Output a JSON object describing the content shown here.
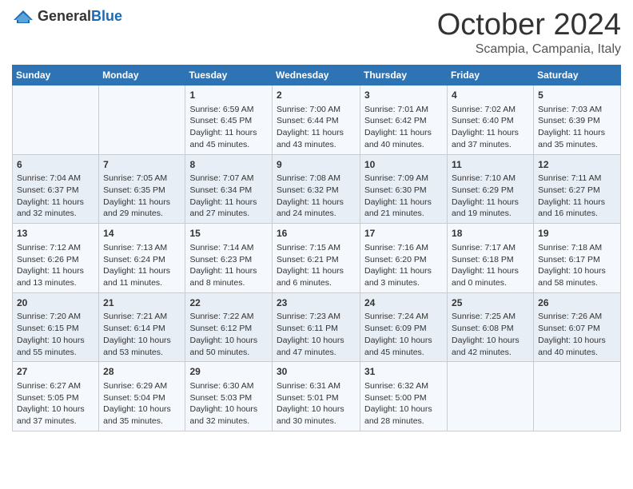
{
  "logo": {
    "general": "General",
    "blue": "Blue"
  },
  "header": {
    "month": "October 2024",
    "location": "Scampia, Campania, Italy"
  },
  "weekdays": [
    "Sunday",
    "Monday",
    "Tuesday",
    "Wednesday",
    "Thursday",
    "Friday",
    "Saturday"
  ],
  "weeks": [
    [
      {
        "day": "",
        "sunrise": "",
        "sunset": "",
        "daylight": ""
      },
      {
        "day": "",
        "sunrise": "",
        "sunset": "",
        "daylight": ""
      },
      {
        "day": "1",
        "sunrise": "Sunrise: 6:59 AM",
        "sunset": "Sunset: 6:45 PM",
        "daylight": "Daylight: 11 hours and 45 minutes."
      },
      {
        "day": "2",
        "sunrise": "Sunrise: 7:00 AM",
        "sunset": "Sunset: 6:44 PM",
        "daylight": "Daylight: 11 hours and 43 minutes."
      },
      {
        "day": "3",
        "sunrise": "Sunrise: 7:01 AM",
        "sunset": "Sunset: 6:42 PM",
        "daylight": "Daylight: 11 hours and 40 minutes."
      },
      {
        "day": "4",
        "sunrise": "Sunrise: 7:02 AM",
        "sunset": "Sunset: 6:40 PM",
        "daylight": "Daylight: 11 hours and 37 minutes."
      },
      {
        "day": "5",
        "sunrise": "Sunrise: 7:03 AM",
        "sunset": "Sunset: 6:39 PM",
        "daylight": "Daylight: 11 hours and 35 minutes."
      }
    ],
    [
      {
        "day": "6",
        "sunrise": "Sunrise: 7:04 AM",
        "sunset": "Sunset: 6:37 PM",
        "daylight": "Daylight: 11 hours and 32 minutes."
      },
      {
        "day": "7",
        "sunrise": "Sunrise: 7:05 AM",
        "sunset": "Sunset: 6:35 PM",
        "daylight": "Daylight: 11 hours and 29 minutes."
      },
      {
        "day": "8",
        "sunrise": "Sunrise: 7:07 AM",
        "sunset": "Sunset: 6:34 PM",
        "daylight": "Daylight: 11 hours and 27 minutes."
      },
      {
        "day": "9",
        "sunrise": "Sunrise: 7:08 AM",
        "sunset": "Sunset: 6:32 PM",
        "daylight": "Daylight: 11 hours and 24 minutes."
      },
      {
        "day": "10",
        "sunrise": "Sunrise: 7:09 AM",
        "sunset": "Sunset: 6:30 PM",
        "daylight": "Daylight: 11 hours and 21 minutes."
      },
      {
        "day": "11",
        "sunrise": "Sunrise: 7:10 AM",
        "sunset": "Sunset: 6:29 PM",
        "daylight": "Daylight: 11 hours and 19 minutes."
      },
      {
        "day": "12",
        "sunrise": "Sunrise: 7:11 AM",
        "sunset": "Sunset: 6:27 PM",
        "daylight": "Daylight: 11 hours and 16 minutes."
      }
    ],
    [
      {
        "day": "13",
        "sunrise": "Sunrise: 7:12 AM",
        "sunset": "Sunset: 6:26 PM",
        "daylight": "Daylight: 11 hours and 13 minutes."
      },
      {
        "day": "14",
        "sunrise": "Sunrise: 7:13 AM",
        "sunset": "Sunset: 6:24 PM",
        "daylight": "Daylight: 11 hours and 11 minutes."
      },
      {
        "day": "15",
        "sunrise": "Sunrise: 7:14 AM",
        "sunset": "Sunset: 6:23 PM",
        "daylight": "Daylight: 11 hours and 8 minutes."
      },
      {
        "day": "16",
        "sunrise": "Sunrise: 7:15 AM",
        "sunset": "Sunset: 6:21 PM",
        "daylight": "Daylight: 11 hours and 6 minutes."
      },
      {
        "day": "17",
        "sunrise": "Sunrise: 7:16 AM",
        "sunset": "Sunset: 6:20 PM",
        "daylight": "Daylight: 11 hours and 3 minutes."
      },
      {
        "day": "18",
        "sunrise": "Sunrise: 7:17 AM",
        "sunset": "Sunset: 6:18 PM",
        "daylight": "Daylight: 11 hours and 0 minutes."
      },
      {
        "day": "19",
        "sunrise": "Sunrise: 7:18 AM",
        "sunset": "Sunset: 6:17 PM",
        "daylight": "Daylight: 10 hours and 58 minutes."
      }
    ],
    [
      {
        "day": "20",
        "sunrise": "Sunrise: 7:20 AM",
        "sunset": "Sunset: 6:15 PM",
        "daylight": "Daylight: 10 hours and 55 minutes."
      },
      {
        "day": "21",
        "sunrise": "Sunrise: 7:21 AM",
        "sunset": "Sunset: 6:14 PM",
        "daylight": "Daylight: 10 hours and 53 minutes."
      },
      {
        "day": "22",
        "sunrise": "Sunrise: 7:22 AM",
        "sunset": "Sunset: 6:12 PM",
        "daylight": "Daylight: 10 hours and 50 minutes."
      },
      {
        "day": "23",
        "sunrise": "Sunrise: 7:23 AM",
        "sunset": "Sunset: 6:11 PM",
        "daylight": "Daylight: 10 hours and 47 minutes."
      },
      {
        "day": "24",
        "sunrise": "Sunrise: 7:24 AM",
        "sunset": "Sunset: 6:09 PM",
        "daylight": "Daylight: 10 hours and 45 minutes."
      },
      {
        "day": "25",
        "sunrise": "Sunrise: 7:25 AM",
        "sunset": "Sunset: 6:08 PM",
        "daylight": "Daylight: 10 hours and 42 minutes."
      },
      {
        "day": "26",
        "sunrise": "Sunrise: 7:26 AM",
        "sunset": "Sunset: 6:07 PM",
        "daylight": "Daylight: 10 hours and 40 minutes."
      }
    ],
    [
      {
        "day": "27",
        "sunrise": "Sunrise: 6:27 AM",
        "sunset": "Sunset: 5:05 PM",
        "daylight": "Daylight: 10 hours and 37 minutes."
      },
      {
        "day": "28",
        "sunrise": "Sunrise: 6:29 AM",
        "sunset": "Sunset: 5:04 PM",
        "daylight": "Daylight: 10 hours and 35 minutes."
      },
      {
        "day": "29",
        "sunrise": "Sunrise: 6:30 AM",
        "sunset": "Sunset: 5:03 PM",
        "daylight": "Daylight: 10 hours and 32 minutes."
      },
      {
        "day": "30",
        "sunrise": "Sunrise: 6:31 AM",
        "sunset": "Sunset: 5:01 PM",
        "daylight": "Daylight: 10 hours and 30 minutes."
      },
      {
        "day": "31",
        "sunrise": "Sunrise: 6:32 AM",
        "sunset": "Sunset: 5:00 PM",
        "daylight": "Daylight: 10 hours and 28 minutes."
      },
      {
        "day": "",
        "sunrise": "",
        "sunset": "",
        "daylight": ""
      },
      {
        "day": "",
        "sunrise": "",
        "sunset": "",
        "daylight": ""
      }
    ]
  ]
}
